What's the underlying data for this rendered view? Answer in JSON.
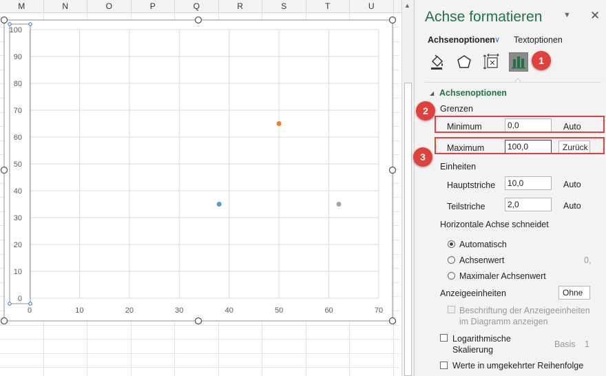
{
  "sheet": {
    "columns": [
      "M",
      "N",
      "O",
      "P",
      "Q",
      "R",
      "S",
      "T",
      "U"
    ]
  },
  "chart_data": {
    "type": "scatter",
    "x": [
      38,
      50,
      62
    ],
    "y": [
      35,
      65,
      35
    ],
    "point_colors": [
      "#5b9bd5",
      "#ed7d31",
      "#a5a5a5"
    ],
    "xlim": [
      0,
      70
    ],
    "ylim": [
      0,
      100
    ],
    "xticks": [
      "0",
      "10",
      "20",
      "30",
      "40",
      "50",
      "60",
      "70"
    ],
    "yticks": [
      "0",
      "10",
      "20",
      "30",
      "40",
      "50",
      "60",
      "70",
      "80",
      "90",
      "100"
    ],
    "grid": true
  },
  "panel": {
    "title": "Achse formatieren",
    "tab_axis": "Achsenoptionen",
    "tab_text": "Textoptionen",
    "icons": [
      "fill-bucket-icon",
      "pentagon-icon",
      "size-properties-icon",
      "bar-chart-icon"
    ],
    "section": "Achsenoptionen",
    "bounds_heading": "Grenzen",
    "minimum_label": "Minimum",
    "minimum_value": "0,0",
    "minimum_btn": "Auto",
    "maximum_label": "Maximum",
    "maximum_value": "100,0",
    "maximum_btn": "Zurück",
    "units_heading": "Einheiten",
    "major_label": "Hauptstriche",
    "major_value": "10,0",
    "major_btn": "Auto",
    "minor_label": "Teilstriche",
    "minor_value": "2,0",
    "minor_btn": "Auto",
    "cross_heading": "Horizontale Achse schneidet",
    "radio_auto": "Automatisch",
    "radio_value": "Achsenwert",
    "radio_value_input": "0,",
    "radio_max": "Maximaler Achsenwert",
    "display_units_label": "Anzeigeeinheiten",
    "display_units_value": "Ohne",
    "display_units_chk": "Beschriftung der Anzeigeeinheiten im Diagramm anzeigen",
    "log_chk": "Logarithmische Skalierung",
    "basis_label": "Basis",
    "basis_value": "1",
    "reverse_chk": "Werte in umgekehrter Reihenfolge"
  },
  "badges": [
    "1",
    "2",
    "3"
  ],
  "colors": {
    "accent": "#217346",
    "highlight": "#e0413d"
  }
}
